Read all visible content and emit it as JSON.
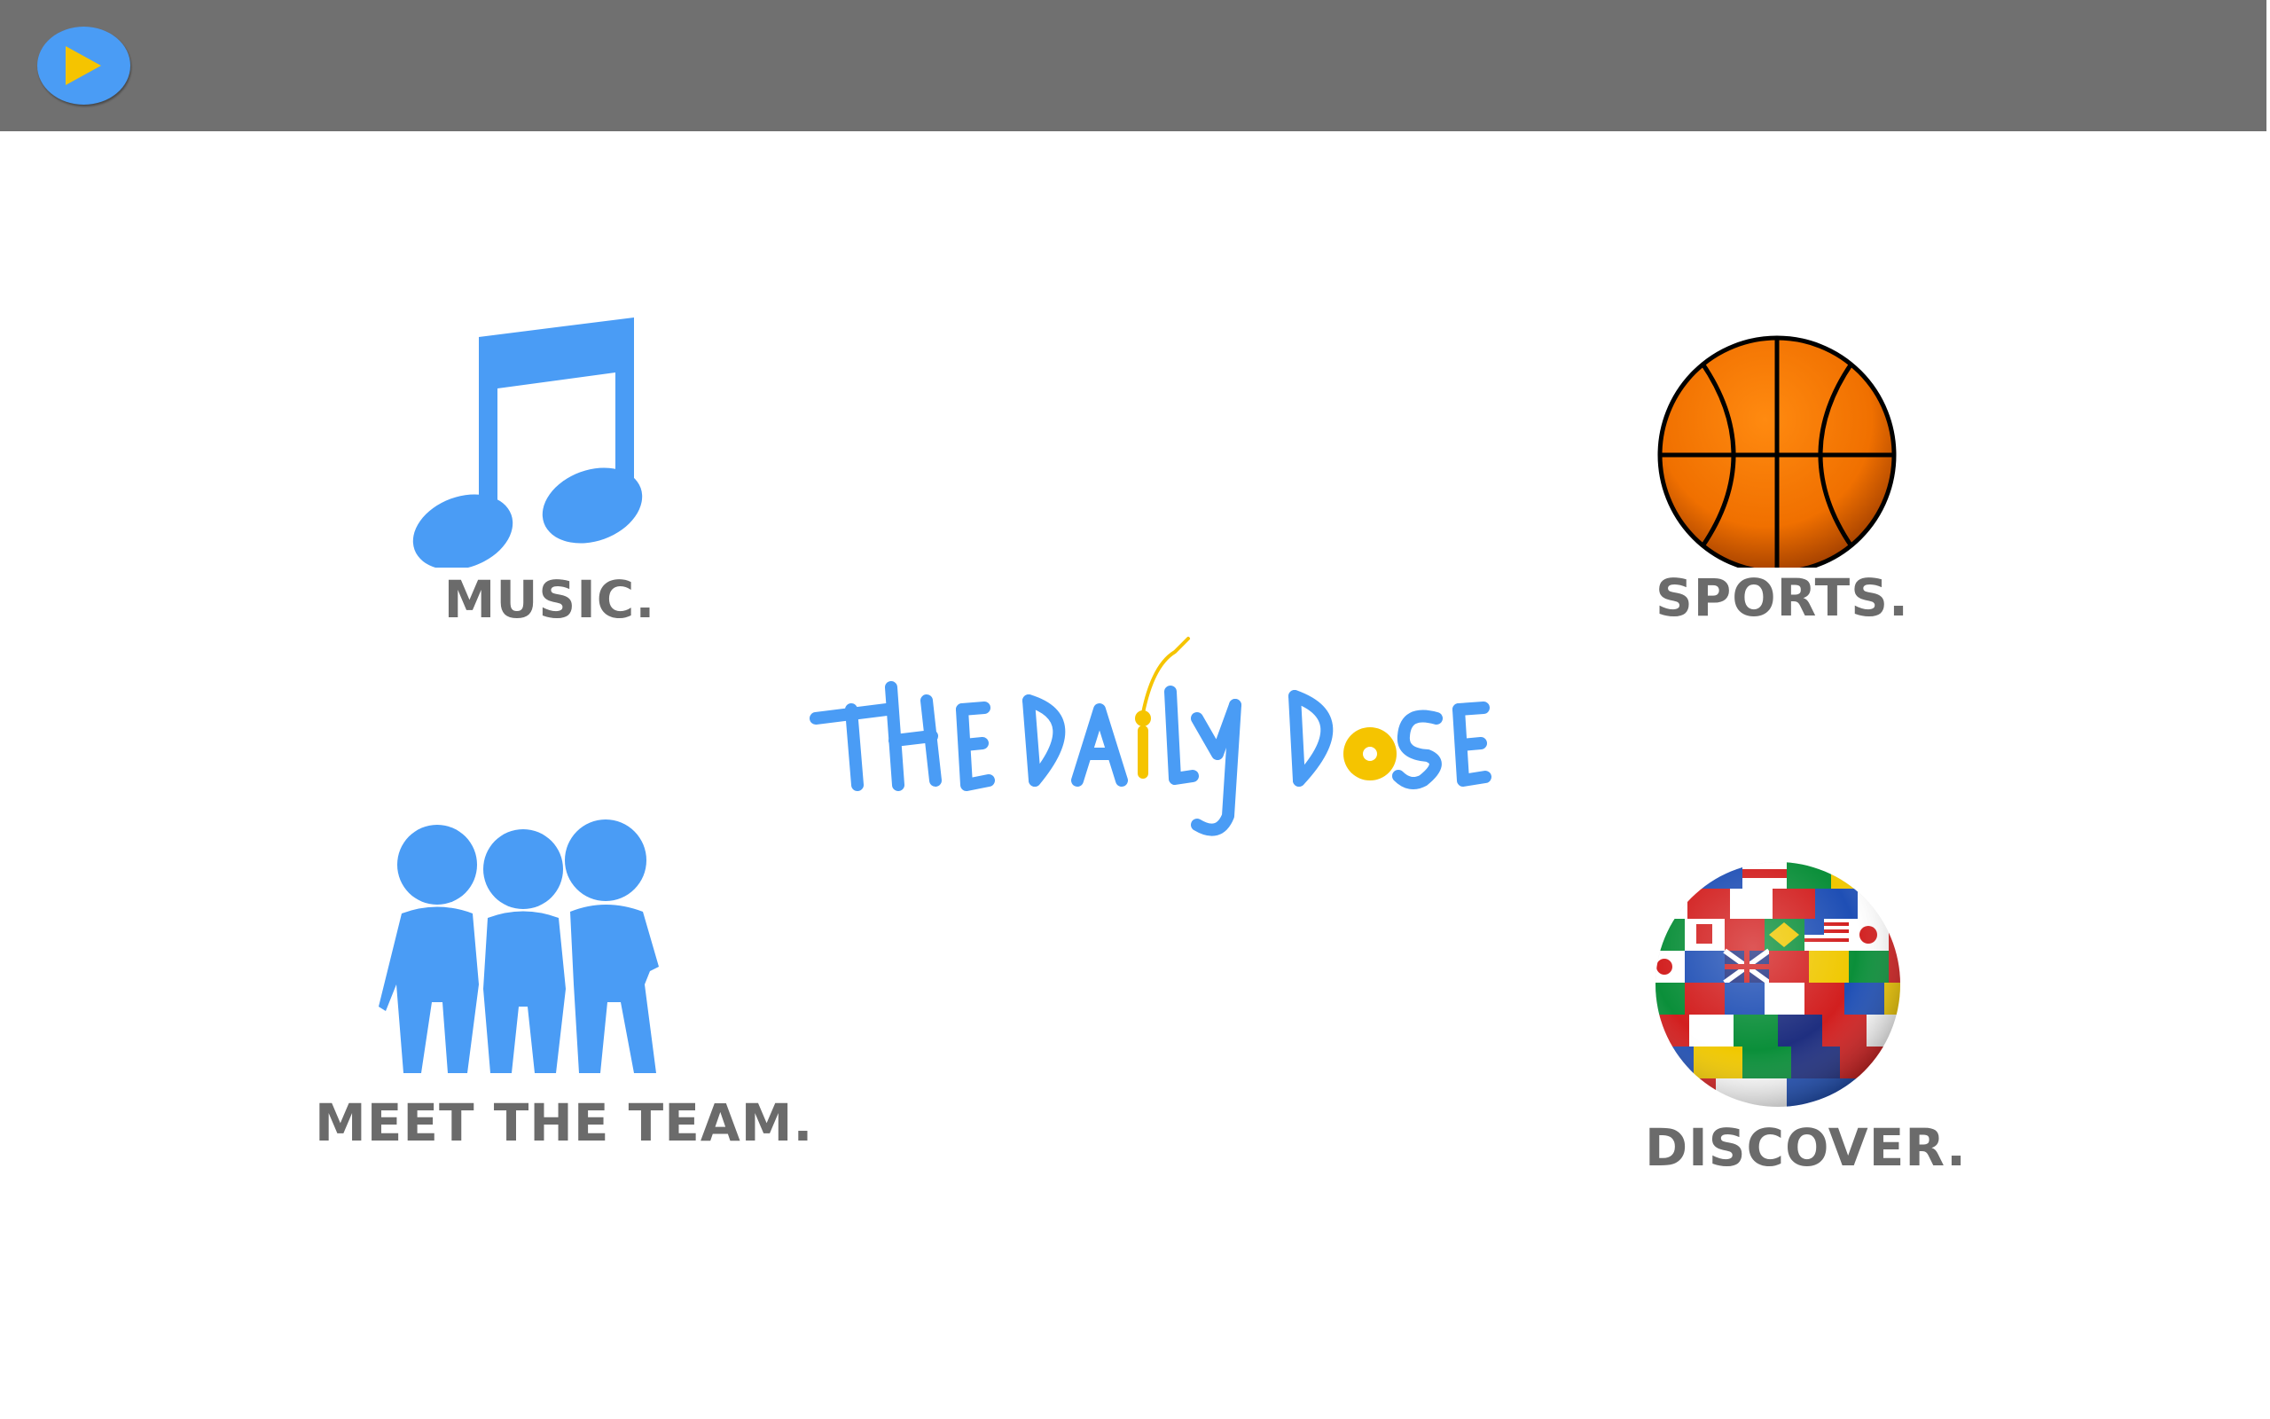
{
  "header": {
    "play_icon": "play-icon",
    "accent": "#4a9cf5",
    "play_color": "#f5c400"
  },
  "logo": {
    "text": "THE DAILY DOSE",
    "color": "#4a9cf5",
    "accent": "#f5c400"
  },
  "menu": {
    "music": {
      "label": "MUSIC.",
      "icon": "music-note-icon"
    },
    "sports": {
      "label": "SPORTS.",
      "icon": "basketball-icon"
    },
    "team": {
      "label": "MEET THE TEAM.",
      "icon": "people-icon"
    },
    "discover": {
      "label": "DISCOVER.",
      "icon": "world-flags-globe-icon"
    }
  }
}
